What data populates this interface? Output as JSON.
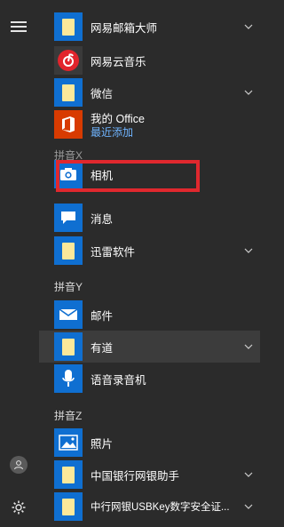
{
  "groups": {
    "x_partial": "拼音X",
    "y": "拼音Y",
    "z": "拼音Z"
  },
  "apps": [
    {
      "label": "网易邮箱大师",
      "icon": "folder-icon",
      "expandable": true
    },
    {
      "label": "网易云音乐",
      "icon": "netease-music-icon",
      "expandable": false
    },
    {
      "label": "微信",
      "icon": "folder-icon",
      "expandable": true
    },
    {
      "label": "我的 Office",
      "sublabel": "最近添加",
      "icon": "office-icon",
      "expandable": false
    },
    {
      "label": "相机",
      "icon": "camera-icon",
      "expandable": false
    },
    {
      "label": "消息",
      "icon": "message-icon",
      "expandable": false
    },
    {
      "label": "迅雷软件",
      "icon": "folder-icon",
      "expandable": true
    },
    {
      "label": "邮件",
      "icon": "mail-icon",
      "expandable": false
    },
    {
      "label": "有道",
      "icon": "folder-icon",
      "expandable": true
    },
    {
      "label": "语音录音机",
      "icon": "microphone-icon",
      "expandable": false
    },
    {
      "label": "照片",
      "icon": "photos-icon",
      "expandable": false
    },
    {
      "label": "中国银行网银助手",
      "icon": "folder-icon",
      "expandable": true
    },
    {
      "label": "中行网银USBKey数字安全证...",
      "icon": "folder-icon",
      "expandable": true
    }
  ],
  "sidebar": {
    "menu_icon": "hamburger-menu-icon",
    "user_icon": "user-avatar-icon",
    "settings_icon": "gear-icon"
  },
  "colors": {
    "background": "#2b2b2b",
    "tile_blue": "#0f6fd1",
    "tile_office": "#d83b01",
    "sublabel": "#6fb4ff",
    "annotation_box": "#e0282e"
  }
}
